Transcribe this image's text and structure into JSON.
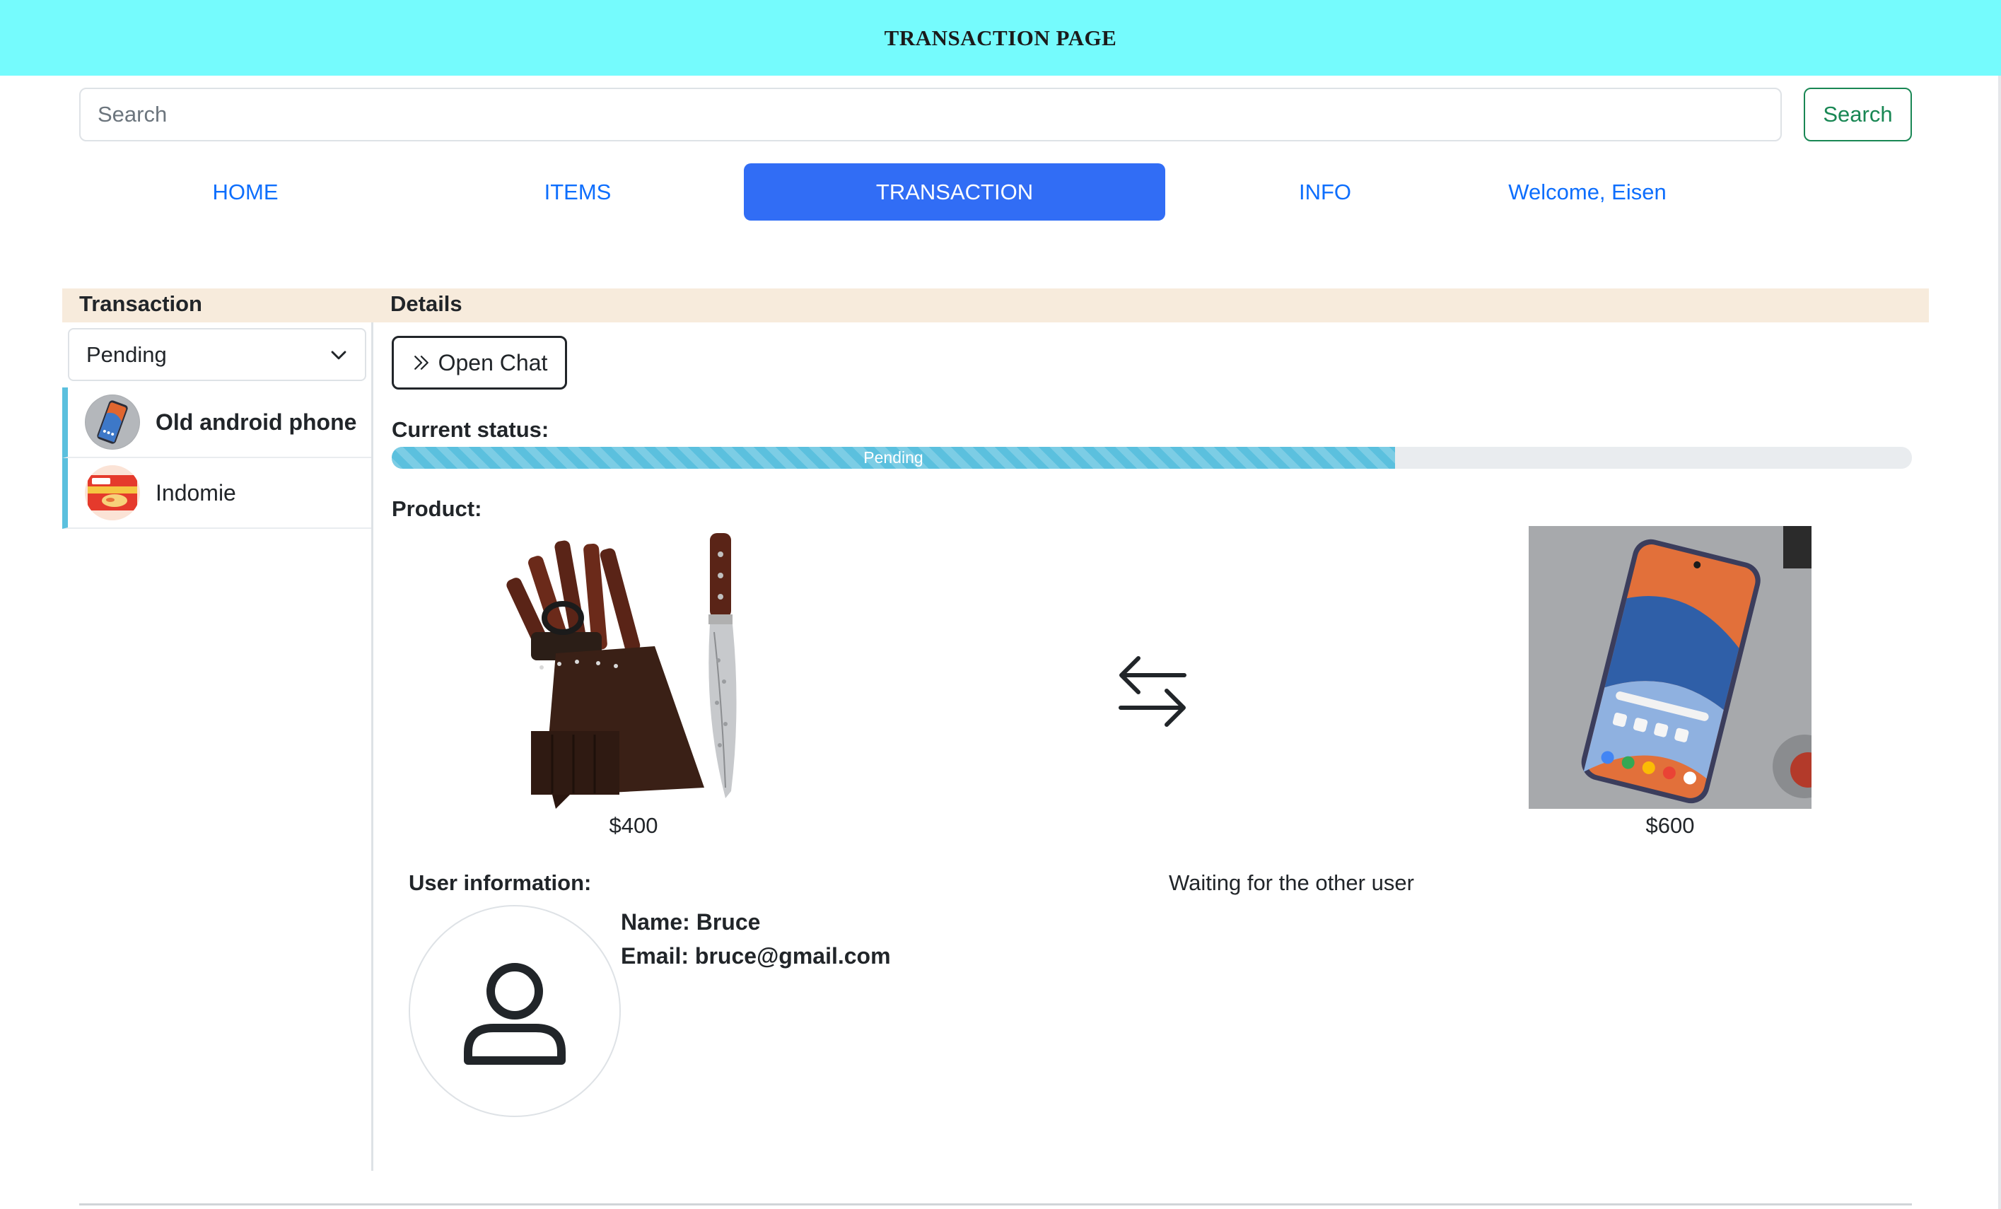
{
  "header": {
    "title": "TRANSACTION PAGE"
  },
  "search": {
    "placeholder": "Search",
    "value": "",
    "button_label": "Search"
  },
  "nav": {
    "items": [
      {
        "label": "HOME",
        "active": false
      },
      {
        "label": "ITEMS",
        "active": false
      },
      {
        "label": "TRANSACTION",
        "active": true
      },
      {
        "label": "INFO",
        "active": false
      }
    ],
    "welcome": "Welcome, Eisen"
  },
  "columns": {
    "transaction": "Transaction",
    "details": "Details"
  },
  "sidebar": {
    "filter": {
      "selected": "Pending"
    },
    "items": [
      {
        "label": "Old android phone",
        "selected": true,
        "thumb_icon": "phone-thumb-icon"
      },
      {
        "label": "Indomie",
        "selected": false,
        "thumb_icon": "noodle-thumb-icon"
      }
    ]
  },
  "details": {
    "open_chat_label": "Open Chat",
    "current_status_label": "Current status:",
    "status": {
      "label": "Pending",
      "progress_percent": 66
    },
    "product_label": "Product:",
    "products": [
      {
        "price": "$400",
        "image_icon": "knife-block-image"
      },
      {
        "price": "$600",
        "image_icon": "android-phone-image"
      }
    ],
    "swap_icon": "swap-arrows-icon",
    "user_info_label": "User information:",
    "waiting_text": "Waiting for the other user",
    "user": {
      "name_line": "Name: Bruce",
      "email_line": "Email: bruce@gmail.com"
    }
  },
  "colors": {
    "topbar": "#75fbfd",
    "primary": "#0d6efd",
    "active_nav": "#316df5",
    "success": "#198754",
    "progress": "#5bc0de",
    "header_strip": "#f7ebdc"
  }
}
